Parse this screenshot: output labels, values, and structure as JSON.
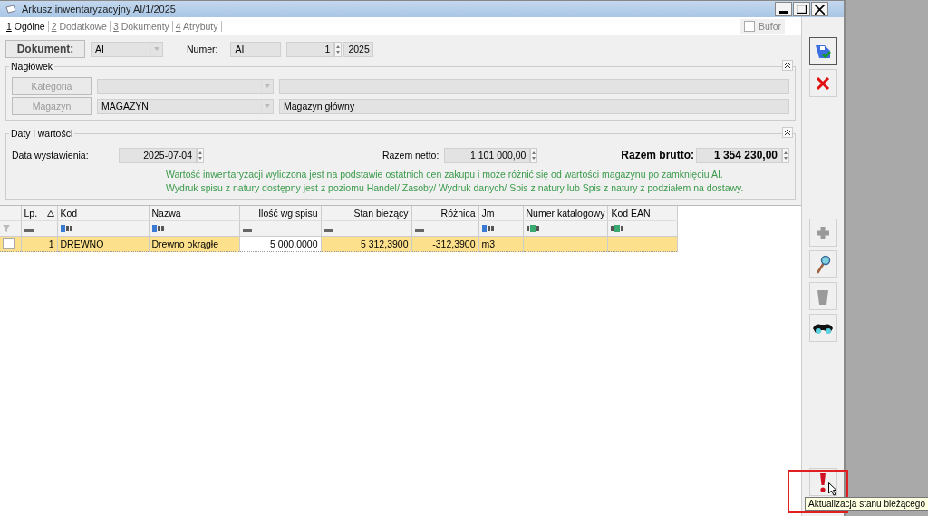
{
  "window": {
    "title": "Arkusz inwentaryzacyjny AI/1/2025"
  },
  "tabs": [
    {
      "key": "1",
      "label": "Ogólne",
      "selected": true
    },
    {
      "key": "2",
      "label": "Dodatkowe",
      "selected": false
    },
    {
      "key": "3",
      "label": "Dokumenty",
      "selected": false
    },
    {
      "key": "4",
      "label": "Atrybuty",
      "selected": false
    }
  ],
  "bufor": {
    "label": "Bufor",
    "checked": false
  },
  "document": {
    "button": "Dokument:",
    "type": "AI",
    "numer_label": "Numer:",
    "numer_prefix": "AI",
    "number": "1",
    "year": "2025"
  },
  "header_section": {
    "title": "Nagłówek",
    "rows": [
      {
        "button": "Kategoria"
      },
      {
        "button": "Magazyn",
        "value": "MAGAZYN",
        "description": "Magazyn główny"
      }
    ]
  },
  "dates_section": {
    "title": "Daty i wartości",
    "date_label": "Data wystawienia:",
    "date": "2025-07-04",
    "netto_label": "Razem netto:",
    "netto": "1 101 000,00",
    "brutto_label": "Razem brutto:",
    "brutto": "1 354 230,00",
    "notes": [
      "Wartość inwentaryzacji wyliczona jest na podstawie ostatnich cen zakupu i może różnić się od wartości magazynu po zamknięciu AI.",
      "Wydruk spisu z natury dostępny jest z poziomu Handel/ Zasoby/ Wydruk danych/ Spis z natury lub Spis z natury z podziałem na dostawy."
    ]
  },
  "table": {
    "columns": [
      {
        "label": "Lp.",
        "kind": "index",
        "sorted": true
      },
      {
        "label": "Kod",
        "kind": "text",
        "sorted": false
      },
      {
        "label": "Nazwa",
        "kind": "text",
        "sorted": false
      },
      {
        "label": "Ilość wg spisu",
        "kind": "number",
        "sorted": false
      },
      {
        "label": "Stan bieżący",
        "kind": "number",
        "sorted": false
      },
      {
        "label": "Różnica",
        "kind": "number",
        "sorted": false
      },
      {
        "label": "Jm",
        "kind": "text",
        "sorted": false
      },
      {
        "label": "Numer katalogowy",
        "kind": "code",
        "sorted": false
      },
      {
        "label": "Kod EAN",
        "kind": "code",
        "sorted": false
      }
    ],
    "rows": [
      {
        "checked": false,
        "selected": true,
        "cells": [
          "1",
          "DREWNO",
          "Drewno okrągłe",
          "5 000,0000",
          "5 312,3900",
          "-312,3900",
          "m3"
        ]
      }
    ]
  },
  "toolbar": {
    "top": [
      {
        "kind": "save"
      },
      {
        "kind": "cancel"
      }
    ],
    "list": [
      {
        "kind": "add",
        "disabled": true
      },
      {
        "kind": "edit",
        "disabled": false
      },
      {
        "kind": "delete",
        "disabled": true
      },
      {
        "kind": "preview",
        "disabled": false
      }
    ],
    "bottom": [
      {
        "kind": "alert",
        "disabled": false,
        "highlighted": true
      }
    ]
  },
  "tooltip": {
    "text": "Aktualizacja stanu bieżącego"
  }
}
